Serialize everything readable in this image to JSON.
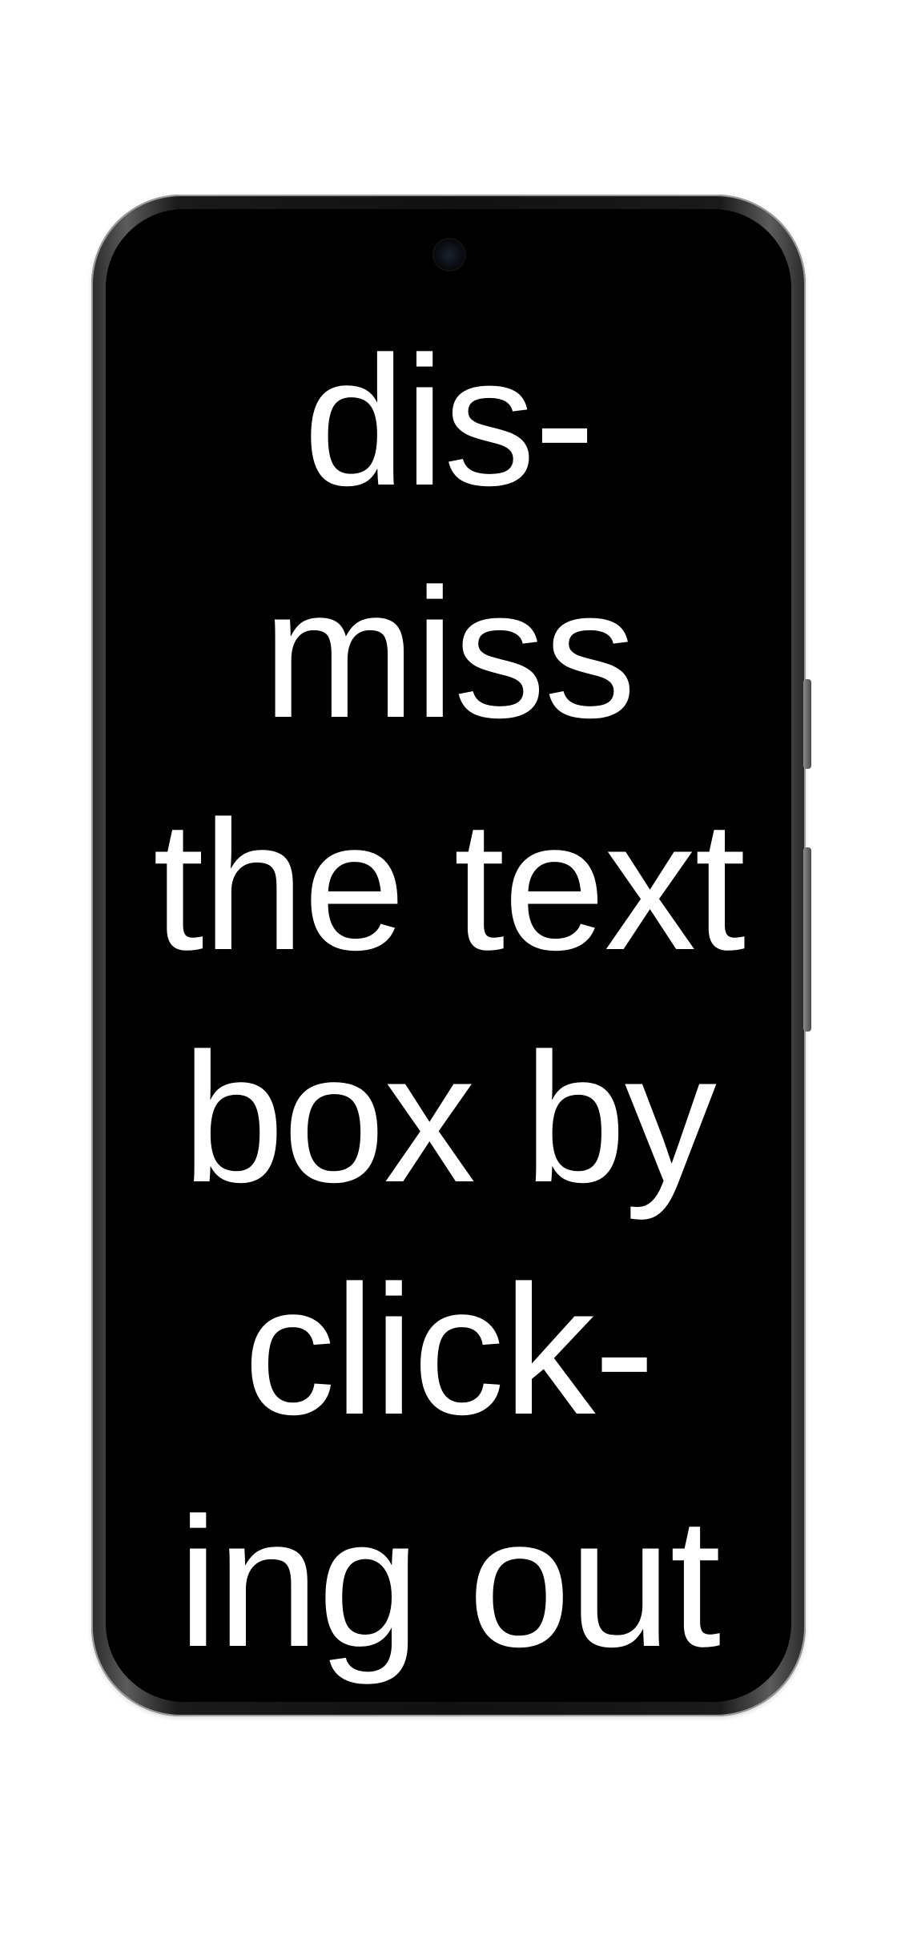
{
  "device": {
    "frame_color": "#222222",
    "screen_color": "#000000",
    "page_background": "#ffffff"
  },
  "message": {
    "lines": [
      "dis-",
      "miss",
      "the text",
      "box by",
      "click-",
      "ing out"
    ]
  }
}
